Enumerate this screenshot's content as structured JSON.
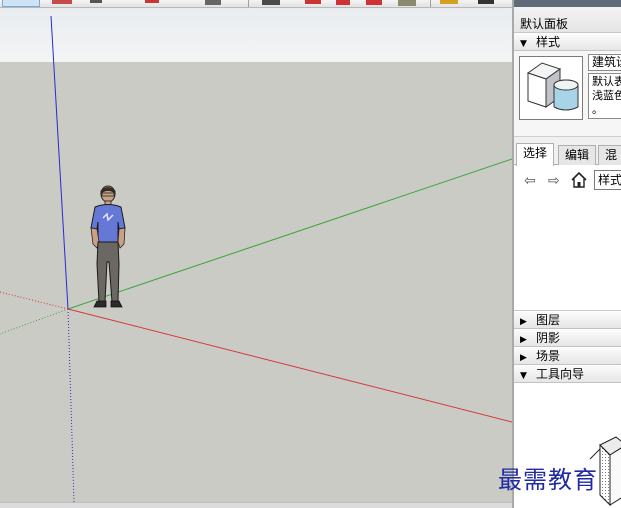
{
  "tray": {
    "title": "默认面板",
    "styles": {
      "header": "样式",
      "style_name": "建筑设",
      "style_description": "默认表\n浅蓝色\n。"
    },
    "tabs": [
      "选择",
      "编辑",
      "混合"
    ],
    "collection": "样式"
  },
  "sections": [
    {
      "label": "图层",
      "expanded": false
    },
    {
      "label": "阴影",
      "expanded": false
    },
    {
      "label": "场景",
      "expanded": false
    },
    {
      "label": "工具向导",
      "expanded": true
    }
  ],
  "icons": {
    "back": "left-arrow-icon",
    "forward": "right-arrow-icon",
    "home": "home-icon"
  },
  "watermark": "最需教育",
  "colors": {
    "x_axis": "#d23a3a",
    "y_axis": "#3aa63a",
    "z_axis": "#2a2acf",
    "ground": "#cbcbc5",
    "sky": "#eef1f3"
  }
}
